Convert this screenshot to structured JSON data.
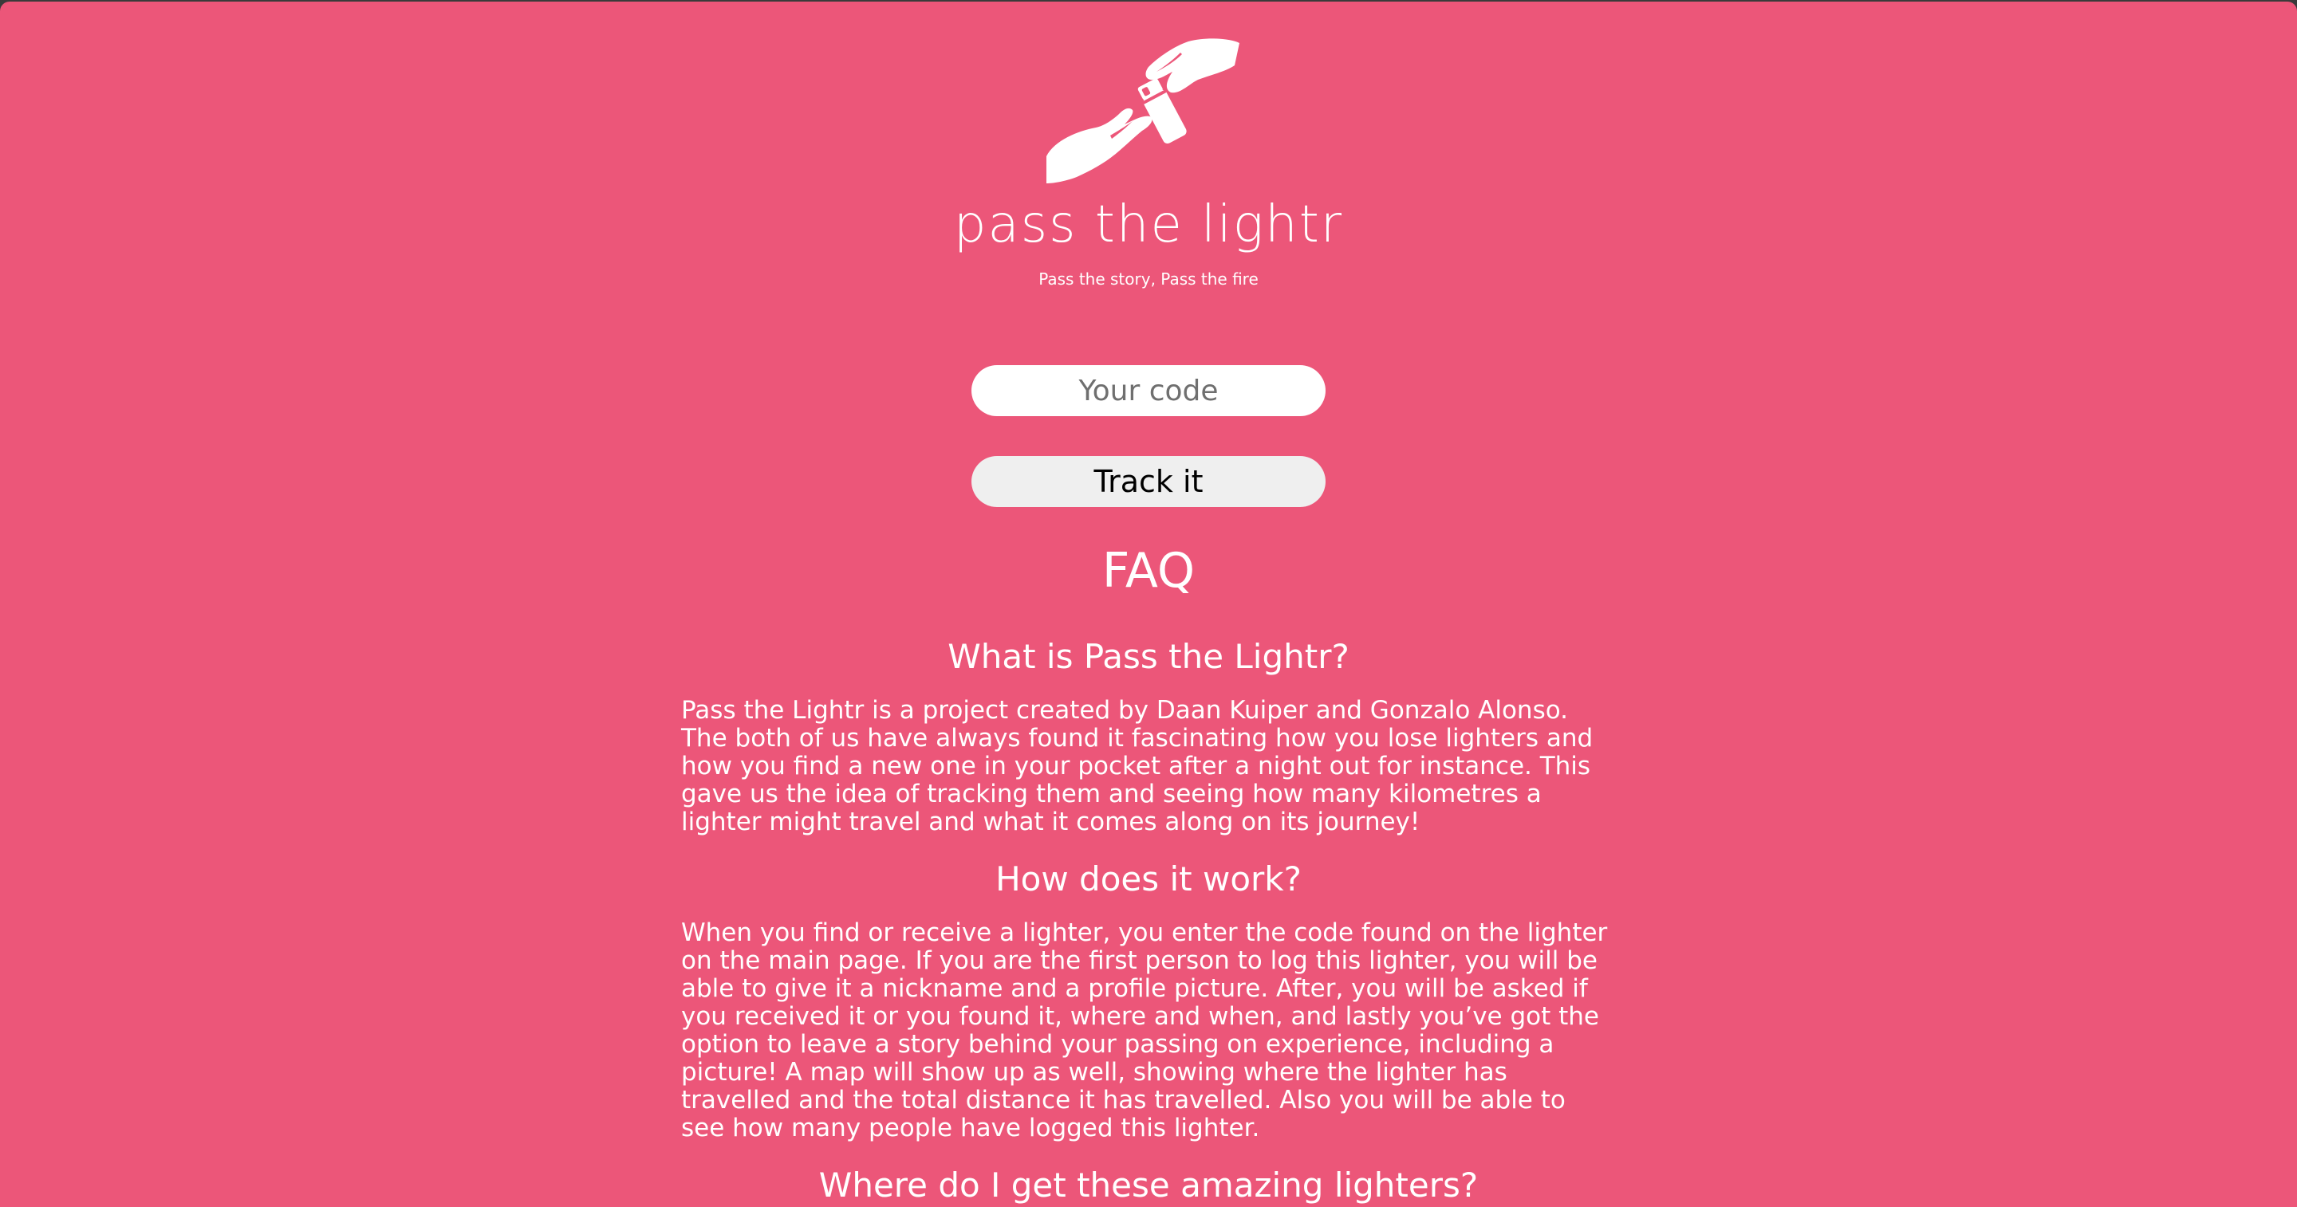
{
  "brand": {
    "title": "pass the lightr",
    "tagline": "Pass the story, Pass the fire",
    "logo_icon": "hand-passing-lighter-icon"
  },
  "tracker": {
    "code_placeholder": "Your code",
    "code_value": "",
    "track_label": "Track it"
  },
  "faq": {
    "heading": "FAQ",
    "items": [
      {
        "question": "What is Pass the Lightr?",
        "answer": "Pass the Lightr is a project created by Daan Kuiper and Gonzalo Alonso. The both of us have always found it fascinating how you lose lighters and how you find a new one in your pocket after a night out for instance. This gave us the idea of tracking them and seeing how many kilometres a lighter might travel and what it comes along on its journey!"
      },
      {
        "question": "How does it work?",
        "answer": "When you find or receive a lighter, you enter the code found on the lighter on the main page. If you are the first person to log this lighter, you will be able to give it a nickname and a profile picture. After, you will be asked if you received it or you found it, where and when, and lastly you’ve got the option to leave a story behind your passing on experience, including a picture! A map will show up as well, showing where the lighter has travelled and the total distance it has travelled. Also you will be able to see how many people have logged this lighter."
      },
      {
        "question": "Where do I get these amazing lighters?",
        "answer": ""
      }
    ]
  },
  "colors": {
    "background": "#ec5679",
    "text": "#ffffff",
    "input_bg": "#ffffff",
    "button_bg": "#efefef"
  }
}
